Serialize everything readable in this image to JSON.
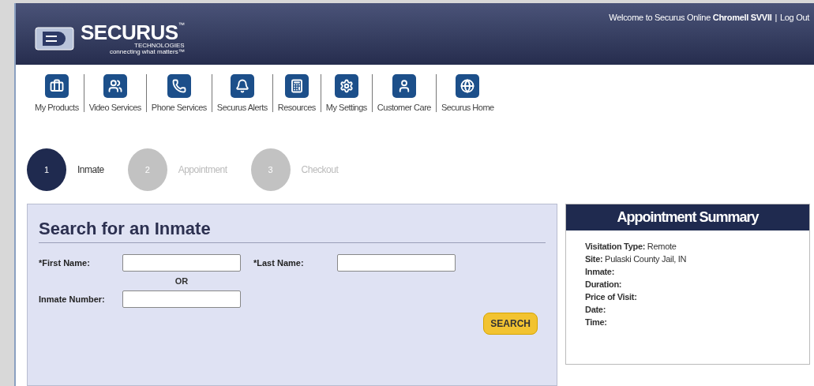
{
  "header": {
    "logo": {
      "name": "SECURUS",
      "trademark": "™",
      "sub": "TECHNOLOGIES",
      "tagline": "connecting what matters™"
    },
    "welcome": "Welcome to Securus Online **Chromell SVVII**",
    "separator": "|",
    "logout": "Log Out"
  },
  "nav": [
    {
      "label": "My Products"
    },
    {
      "label": "Video Services"
    },
    {
      "label": "Phone Services"
    },
    {
      "label": "Securus Alerts"
    },
    {
      "label": "Resources"
    },
    {
      "label": "My Settings"
    },
    {
      "label": "Customer Care"
    },
    {
      "label": "Securus Home"
    }
  ],
  "steps": [
    {
      "number": "1",
      "label": "Inmate",
      "selected": true
    },
    {
      "number": "2",
      "label": "Appointment",
      "selected": false
    },
    {
      "number": "3",
      "label": "Checkout",
      "selected": false
    }
  ],
  "search": {
    "title": "Search for an Inmate",
    "first_name": "*First Name:",
    "last_name": "*Last Name:",
    "or": "OR",
    "inmate_number": "Inmate Number:",
    "button": "SEARCH"
  },
  "summary": {
    "title": "Appointment Summary",
    "rows": [
      {
        "label": "Visitation Type:",
        "value": "Remote"
      },
      {
        "label": "Site:",
        "value": "Pulaski County Jail, IN"
      },
      {
        "label": "Inmate:"
      },
      {
        "label": "Duration:"
      },
      {
        "label": "Price of Visit:"
      },
      {
        "label": "Date:"
      },
      {
        "label": "Time:"
      }
    ]
  }
}
